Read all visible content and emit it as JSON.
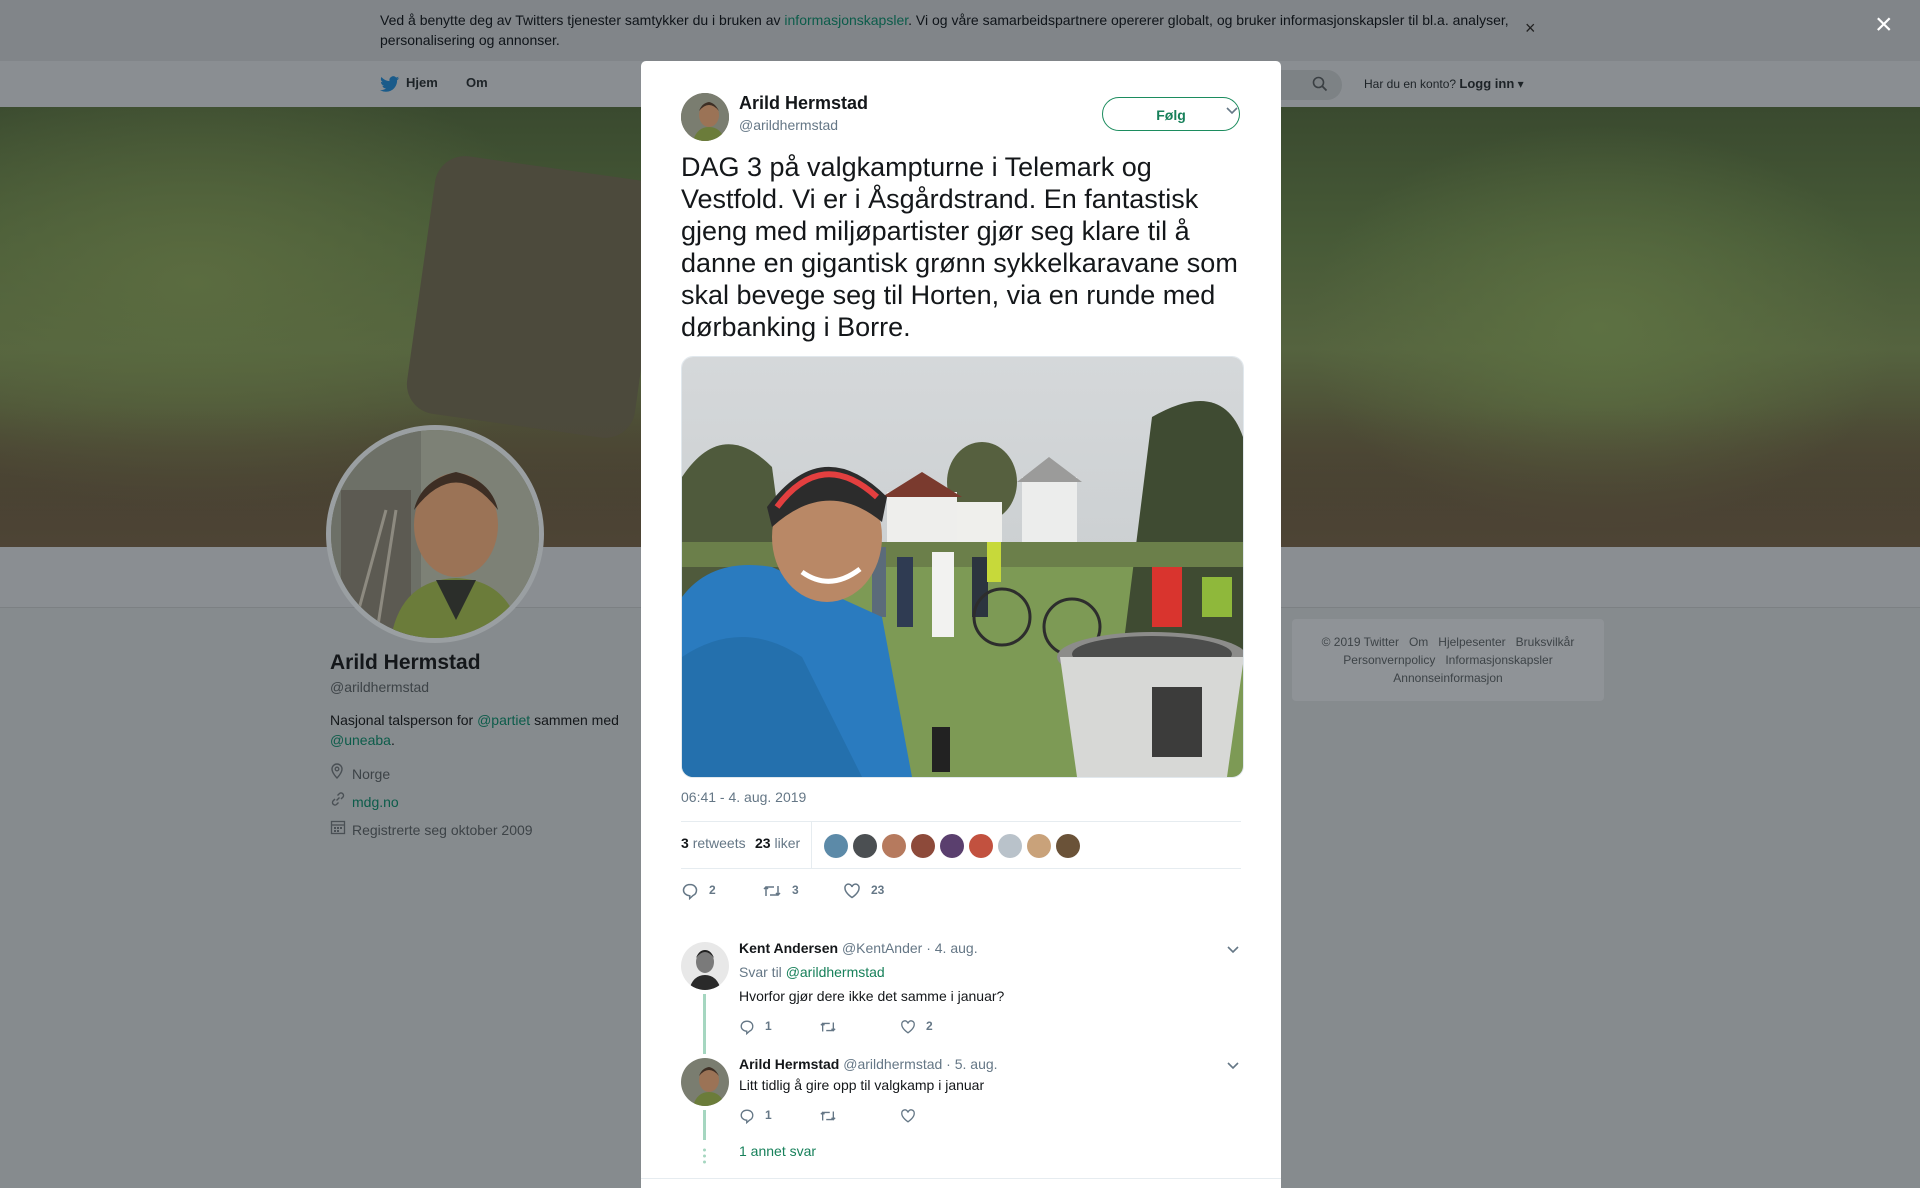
{
  "cookie_banner": {
    "text_before": "Ved å benytte deg av Twitters tjenester samtykker du i bruken av ",
    "link": "informasjonskapsler",
    "text_after": ". Vi og våre samarbeidspartnere opererer globalt, og bruker informasjonskapsler til bl.a. analyser, personalisering og annonser.",
    "close": "×"
  },
  "page_close": "×",
  "nav": {
    "home": "Hjem",
    "about": "Om",
    "account_prompt": "Har du en konto?",
    "login": "Logg inn"
  },
  "profile": {
    "name": "Arild Hermstad",
    "handle": "@arildhermstad",
    "bio_before": "Nasjonal talsperson for ",
    "bio_link1": "@partiet",
    "bio_mid": " sammen med ",
    "bio_link2": "@uneaba",
    "bio_end": ".",
    "location": "Norge",
    "website": "mdg.no",
    "joined": "Registrerte seg oktober 2009"
  },
  "footer": {
    "links": [
      "© 2019 Twitter",
      "Om",
      "Hjelpesenter",
      "Bruksvilkår",
      "Personvernpolicy",
      "Informasjonskapsler",
      "Annonseinformasjon"
    ]
  },
  "tweet": {
    "author_name": "Arild Hermstad",
    "author_handle": "@arildhermstad",
    "follow_label": "Følg",
    "text": "DAG 3 på valgkampturne i Telemark og Vestfold. Vi er i Åsgårdstrand. En fantastisk gjeng med miljøpartister gjør seg klare til å danne en gigantisk grønn sykkelkaravane som skal bevege seg til Horten, via en runde med dørbanking i Borre.",
    "timestamp": "06:41 - 4. aug. 2019",
    "retweets_count": "3",
    "retweets_label": "retweets",
    "likes_count": "23",
    "likes_label": "liker",
    "actions": {
      "replies": "2",
      "retweets": "3",
      "likes": "23"
    }
  },
  "replies": [
    {
      "name": "Kent Andersen",
      "handle": "@KentAnder",
      "date": "· 4. aug.",
      "reply_to_label": "Svar til ",
      "reply_to": "@arildhermstad",
      "text": "Hvorfor gjør dere ikke det samme i januar?",
      "replies": "1",
      "retweets": "",
      "likes": "2"
    },
    {
      "name": "Arild Hermstad",
      "handle": "@arildhermstad",
      "date": "· 5. aug.",
      "text": "Litt tidlig å gire opp til valgkamp i januar",
      "replies": "1",
      "retweets": "",
      "likes": ""
    }
  ],
  "more_replies": "1 annet svar",
  "colors": {
    "accent": "#17805a",
    "thread": "#a5d6c0",
    "overlay": "#868b8e"
  }
}
